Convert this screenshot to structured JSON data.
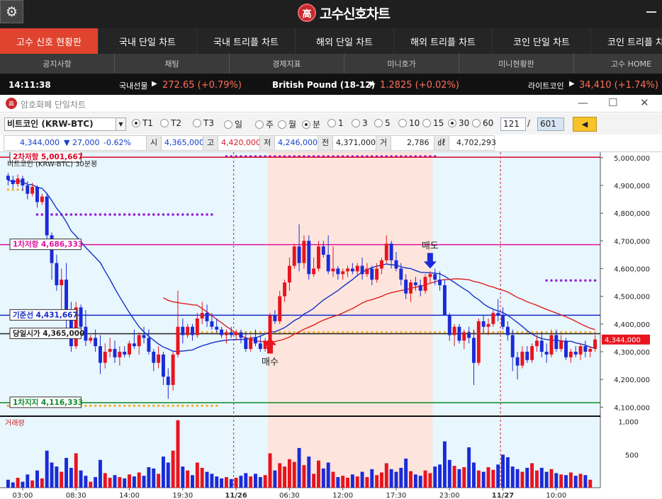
{
  "app": {
    "title": "고수신호차트",
    "logo_char": "高",
    "gear_icon": "gear-icon"
  },
  "tabs": [
    "고수 신호 현황판",
    "국내 단일 차트",
    "국내 트리플 차트",
    "해외 단일 차트",
    "해외 트리플 차트",
    "코인 단일 차트",
    "코인 트리플 차트"
  ],
  "subnav": [
    "공지사항",
    "채팅",
    "경제지표",
    "미니호가",
    "미니현황판",
    "고수 HOME"
  ],
  "ticker": {
    "time": "14:11:38",
    "items": [
      {
        "label": "국내선물",
        "arrow": "▶",
        "value": "272.65 (+0.79%)"
      },
      {
        "label": "British Pound (18-12)",
        "arrow": "▶",
        "value": "1.2825 (+0.02%)"
      },
      {
        "label": "라이트코인",
        "arrow": "▶",
        "value": "34,410 (+1.74%)"
      }
    ]
  },
  "window": {
    "title": "암호화폐 단일차트",
    "logo_char": "高"
  },
  "controls": {
    "coin": "비트코인 (KRW-BTC)",
    "radios": [
      {
        "label": "T1",
        "checked": true
      },
      {
        "label": "T2",
        "checked": false
      },
      {
        "label": "T3",
        "checked": false
      },
      {
        "label": "일",
        "checked": false
      },
      {
        "label": "주",
        "checked": false
      },
      {
        "label": "월",
        "checked": false
      },
      {
        "label": "분",
        "checked": true
      },
      {
        "label": "1",
        "checked": false
      },
      {
        "label": "3",
        "checked": false
      },
      {
        "label": "5",
        "checked": false
      },
      {
        "label": "10",
        "checked": false
      },
      {
        "label": "15",
        "checked": false
      },
      {
        "label": "30",
        "checked": true
      },
      {
        "label": "60",
        "checked": false
      }
    ],
    "page_current": "121",
    "page_sep": "/",
    "page_total": "601",
    "nav_arrow": "◀"
  },
  "pricebar": {
    "price": "4,344,000",
    "change": "▼ 27,000",
    "pct": "-0.62%",
    "open_label": "시",
    "open": "4,365,000",
    "high_label": "고",
    "high": "4,420,000",
    "low_label": "저",
    "low": "4,246,000",
    "prev_label": "전",
    "prev": "4,371,000",
    "vol_label": "거",
    "vol": "2,786",
    "amt_label": "㎗",
    "amt": "4,702,293"
  },
  "chart_data": {
    "type": "candlestick",
    "title": "비트코인 (KRW-BTC) 30분봉",
    "volume_label": "거래량",
    "y_ticks": [
      5000000,
      4900000,
      4800000,
      4700000,
      4600000,
      4500000,
      4400000,
      4300000,
      4200000,
      4100000
    ],
    "y_tick_labels": [
      "5,000,000",
      "4,900,000",
      "4,800,000",
      "4,700,000",
      "4,600,000",
      "4,500,000",
      "4,400,000",
      "4,300,000",
      "4,200,000",
      "4,100,000"
    ],
    "ylim": [
      4070000,
      5020000
    ],
    "volume_ticks": [
      1000,
      500
    ],
    "volume_tick_labels": [
      "1,000",
      "500"
    ],
    "volume_max": 1070,
    "x_labels": [
      {
        "label": "03:00",
        "index": 3
      },
      {
        "label": "08:30",
        "index": 14
      },
      {
        "label": "14:00",
        "index": 25
      },
      {
        "label": "19:30",
        "index": 36
      },
      {
        "label": "11/26",
        "index": 47,
        "bold": true
      },
      {
        "label": "06:30",
        "index": 58
      },
      {
        "label": "12:00",
        "index": 69
      },
      {
        "label": "17:30",
        "index": 80
      },
      {
        "label": "23:00",
        "index": 91
      },
      {
        "label": "11/27",
        "index": 102,
        "bold": true
      },
      {
        "label": "10:00",
        "index": 113
      }
    ],
    "day_separators": [
      47,
      102
    ],
    "current_price": {
      "label": "4,344,000",
      "value": 4344000
    },
    "levels": [
      {
        "name": "2차저항",
        "label": "2차저항 5,001,667",
        "value": 5001667,
        "color": "#dd0022"
      },
      {
        "name": "1차저항",
        "label": "1차저항 4,686,333",
        "value": 4686333,
        "color": "#e0109e"
      },
      {
        "name": "기준선",
        "label": "기준선 4,431,667",
        "value": 4431667,
        "color": "#1428c8"
      },
      {
        "name": "당일시가",
        "label": "당일시가 4,365,000",
        "value": 4365000,
        "color": "#222222"
      },
      {
        "name": "1차지지",
        "label": "1차지지 4,116,333",
        "value": 4116333,
        "color": "#0a8a2a"
      }
    ],
    "signals": [
      {
        "label": "매수",
        "index": 54,
        "value": 4360000,
        "direction": "up"
      },
      {
        "label": "매도",
        "index": 87,
        "value": 4590000,
        "direction": "down"
      }
    ],
    "ohlc": [
      [
        4935000,
        4945000,
        4900000,
        4920000
      ],
      [
        4920000,
        4935000,
        4890000,
        4905000
      ],
      [
        4905000,
        4940000,
        4895000,
        4925000
      ],
      [
        4925000,
        4935000,
        4880000,
        4900000
      ],
      [
        4900000,
        4915000,
        4850000,
        4870000
      ],
      [
        4870000,
        4910000,
        4860000,
        4895000
      ],
      [
        4895000,
        4900000,
        4820000,
        4840000
      ],
      [
        4840000,
        4870000,
        4830000,
        4860000
      ],
      [
        4860000,
        4870000,
        4700000,
        4720000
      ],
      [
        4720000,
        4730000,
        4560000,
        4620000
      ],
      [
        4620000,
        4650000,
        4520000,
        4540000
      ],
      [
        4540000,
        4600000,
        4430000,
        4560000
      ],
      [
        4560000,
        4620000,
        4380000,
        4430000
      ],
      [
        4430000,
        4480000,
        4300000,
        4320000
      ],
      [
        4320000,
        4480000,
        4310000,
        4460000
      ],
      [
        4460000,
        4470000,
        4360000,
        4390000
      ],
      [
        4390000,
        4450000,
        4320000,
        4340000
      ],
      [
        4340000,
        4360000,
        4330000,
        4350000
      ],
      [
        4350000,
        4380000,
        4300000,
        4320000
      ],
      [
        4320000,
        4360000,
        4220000,
        4260000
      ],
      [
        4260000,
        4330000,
        4240000,
        4300000
      ],
      [
        4300000,
        4350000,
        4280000,
        4310000
      ],
      [
        4310000,
        4340000,
        4260000,
        4280000
      ],
      [
        4280000,
        4320000,
        4250000,
        4300000
      ],
      [
        4300000,
        4320000,
        4280000,
        4290000
      ],
      [
        4290000,
        4340000,
        4280000,
        4330000
      ],
      [
        4330000,
        4380000,
        4310000,
        4320000
      ],
      [
        4320000,
        4370000,
        4290000,
        4360000
      ],
      [
        4360000,
        4390000,
        4330000,
        4350000
      ],
      [
        4350000,
        4380000,
        4290000,
        4300000
      ],
      [
        4300000,
        4310000,
        4230000,
        4260000
      ],
      [
        4260000,
        4320000,
        4240000,
        4290000
      ],
      [
        4290000,
        4300000,
        4180000,
        4210000
      ],
      [
        4210000,
        4240000,
        4130000,
        4180000
      ],
      [
        4180000,
        4300000,
        4160000,
        4290000
      ],
      [
        4290000,
        4520000,
        4280000,
        4390000
      ],
      [
        4390000,
        4420000,
        4330000,
        4360000
      ],
      [
        4360000,
        4400000,
        4350000,
        4390000
      ],
      [
        4390000,
        4400000,
        4340000,
        4360000
      ],
      [
        4360000,
        4440000,
        4350000,
        4420000
      ],
      [
        4420000,
        4480000,
        4400000,
        4440000
      ],
      [
        4440000,
        4470000,
        4390000,
        4410000
      ],
      [
        4410000,
        4440000,
        4380000,
        4390000
      ],
      [
        4390000,
        4420000,
        4370000,
        4380000
      ],
      [
        4380000,
        4390000,
        4350000,
        4360000
      ],
      [
        4360000,
        4380000,
        4330000,
        4370000
      ],
      [
        4370000,
        4390000,
        4350000,
        4360000
      ],
      [
        4360000,
        4380000,
        4340000,
        4370000
      ],
      [
        4370000,
        4380000,
        4330000,
        4350000
      ],
      [
        4350000,
        4370000,
        4300000,
        4310000
      ],
      [
        4310000,
        4360000,
        4300000,
        4350000
      ],
      [
        4350000,
        4380000,
        4320000,
        4330000
      ],
      [
        4330000,
        4360000,
        4300000,
        4310000
      ],
      [
        4310000,
        4350000,
        4300000,
        4340000
      ],
      [
        4340000,
        4440000,
        4330000,
        4430000
      ],
      [
        4430000,
        4450000,
        4400000,
        4410000
      ],
      [
        4410000,
        4520000,
        4400000,
        4500000
      ],
      [
        4500000,
        4560000,
        4480000,
        4550000
      ],
      [
        4550000,
        4640000,
        4520000,
        4610000
      ],
      [
        4610000,
        4690000,
        4600000,
        4680000
      ],
      [
        4680000,
        4760000,
        4590000,
        4620000
      ],
      [
        4620000,
        4720000,
        4600000,
        4700000
      ],
      [
        4700000,
        4720000,
        4560000,
        4580000
      ],
      [
        4580000,
        4640000,
        4570000,
        4600000
      ],
      [
        4600000,
        4700000,
        4590000,
        4680000
      ],
      [
        4680000,
        4700000,
        4640000,
        4650000
      ],
      [
        4650000,
        4720000,
        4580000,
        4590000
      ],
      [
        4590000,
        4680000,
        4570000,
        4600000
      ],
      [
        4600000,
        4610000,
        4560000,
        4580000
      ],
      [
        4580000,
        4600000,
        4560000,
        4590000
      ],
      [
        4590000,
        4610000,
        4570000,
        4600000
      ],
      [
        4600000,
        4620000,
        4580000,
        4590000
      ],
      [
        4590000,
        4620000,
        4570000,
        4610000
      ],
      [
        4610000,
        4640000,
        4560000,
        4580000
      ],
      [
        4580000,
        4620000,
        4570000,
        4600000
      ],
      [
        4600000,
        4610000,
        4540000,
        4560000
      ],
      [
        4560000,
        4620000,
        4550000,
        4600000
      ],
      [
        4600000,
        4640000,
        4580000,
        4630000
      ],
      [
        4630000,
        4720000,
        4620000,
        4690000
      ],
      [
        4690000,
        4700000,
        4600000,
        4630000
      ],
      [
        4630000,
        4660000,
        4590000,
        4600000
      ],
      [
        4600000,
        4620000,
        4540000,
        4560000
      ],
      [
        4560000,
        4580000,
        4490000,
        4510000
      ],
      [
        4510000,
        4560000,
        4480000,
        4550000
      ],
      [
        4550000,
        4570000,
        4520000,
        4540000
      ],
      [
        4540000,
        4560000,
        4500000,
        4520000
      ],
      [
        4520000,
        4580000,
        4510000,
        4570000
      ],
      [
        4570000,
        4590000,
        4550000,
        4580000
      ],
      [
        4580000,
        4600000,
        4540000,
        4560000
      ],
      [
        4560000,
        4590000,
        4520000,
        4540000
      ],
      [
        4540000,
        4560000,
        4480000,
        4430000
      ],
      [
        4430000,
        4440000,
        4340000,
        4360000
      ],
      [
        4360000,
        4400000,
        4320000,
        4390000
      ],
      [
        4390000,
        4400000,
        4330000,
        4340000
      ],
      [
        4340000,
        4380000,
        4310000,
        4370000
      ],
      [
        4370000,
        4390000,
        4330000,
        4350000
      ],
      [
        4350000,
        4380000,
        4180000,
        4260000
      ],
      [
        4260000,
        4420000,
        4250000,
        4410000
      ],
      [
        4410000,
        4430000,
        4370000,
        4390000
      ],
      [
        4390000,
        4420000,
        4360000,
        4400000
      ],
      [
        4400000,
        4450000,
        4390000,
        4440000
      ],
      [
        4440000,
        4490000,
        4410000,
        4430000
      ],
      [
        4430000,
        4460000,
        4380000,
        4390000
      ],
      [
        4390000,
        4410000,
        4340000,
        4360000
      ],
      [
        4360000,
        4380000,
        4230000,
        4280000
      ],
      [
        4280000,
        4300000,
        4200000,
        4250000
      ],
      [
        4250000,
        4320000,
        4240000,
        4300000
      ],
      [
        4300000,
        4320000,
        4260000,
        4270000
      ],
      [
        4270000,
        4330000,
        4260000,
        4320000
      ],
      [
        4320000,
        4360000,
        4300000,
        4340000
      ],
      [
        4340000,
        4370000,
        4280000,
        4300000
      ],
      [
        4300000,
        4330000,
        4260000,
        4290000
      ],
      [
        4290000,
        4380000,
        4280000,
        4360000
      ],
      [
        4360000,
        4380000,
        4300000,
        4310000
      ],
      [
        4310000,
        4360000,
        4300000,
        4340000
      ],
      [
        4340000,
        4350000,
        4270000,
        4280000
      ],
      [
        4280000,
        4310000,
        4260000,
        4300000
      ],
      [
        4300000,
        4320000,
        4280000,
        4290000
      ],
      [
        4290000,
        4330000,
        4270000,
        4320000
      ],
      [
        4320000,
        4340000,
        4280000,
        4300000
      ],
      [
        4300000,
        4320000,
        4280000,
        4310000
      ],
      [
        4310000,
        4360000,
        4300000,
        4344000
      ]
    ],
    "volumes": [
      120,
      80,
      150,
      90,
      200,
      110,
      260,
      140,
      560,
      380,
      320,
      240,
      450,
      300,
      520,
      260,
      180,
      90,
      160,
      420,
      220,
      150,
      190,
      160,
      140,
      200,
      170,
      230,
      180,
      310,
      290,
      210,
      470,
      380,
      560,
      1020,
      320,
      260,
      190,
      380,
      300,
      240,
      210,
      170,
      140,
      160,
      130,
      150,
      180,
      220,
      170,
      210,
      160,
      190,
      520,
      260,
      370,
      320,
      430,
      390,
      600,
      340,
      470,
      210,
      410,
      290,
      380,
      240,
      160,
      180,
      150,
      200,
      170,
      240,
      160,
      280,
      190,
      230,
      370,
      280,
      240,
      300,
      440,
      250,
      200,
      180,
      260,
      220,
      320,
      350,
      700,
      420,
      330,
      280,
      310,
      610,
      380,
      260,
      240,
      310,
      270,
      350,
      500,
      460,
      320,
      280,
      240,
      300,
      370,
      260,
      300,
      240,
      280,
      220,
      200,
      190,
      230,
      180,
      210,
      190,
      120
    ]
  }
}
